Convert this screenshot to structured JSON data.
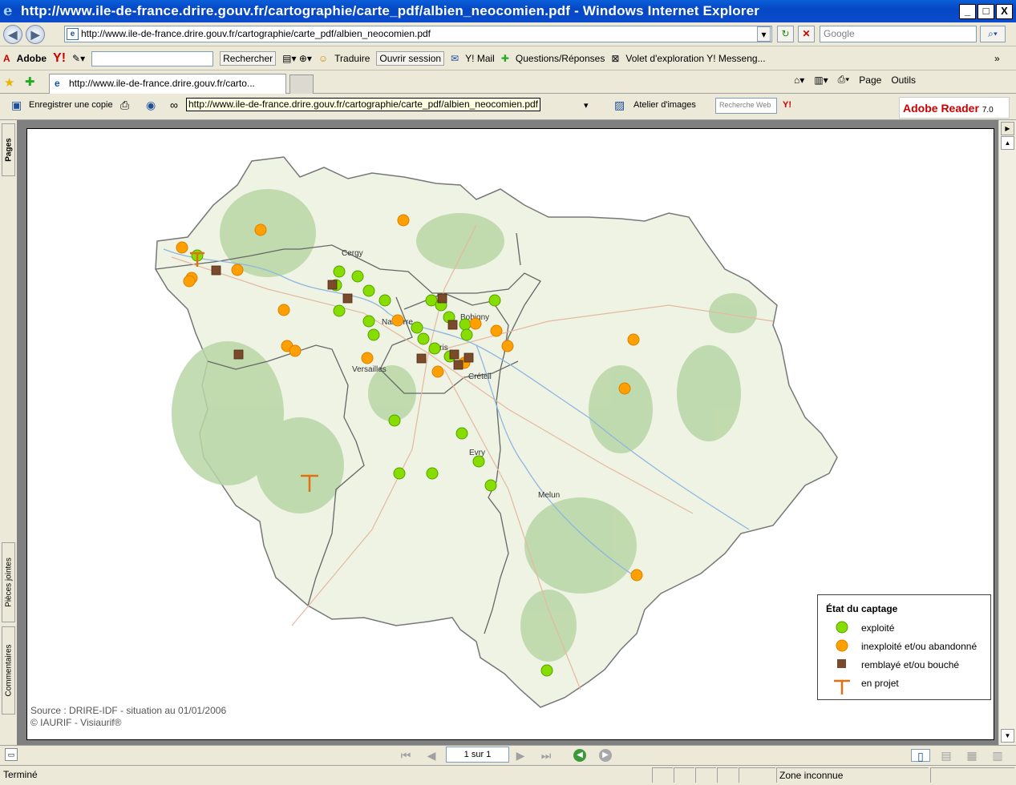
{
  "window": {
    "title": "http://www.ile-de-france.drire.gouv.fr/cartographie/carte_pdf/albien_neocomien.pdf - Windows Internet Explorer",
    "minimize": "_",
    "maximize": "□",
    "close": "X"
  },
  "address": {
    "url": "http://www.ile-de-france.drire.gouv.fr/cartographie/carte_pdf/albien_neocomien.pdf",
    "search_placeholder": "Google"
  },
  "links_toolbar": {
    "adobe": "Adobe",
    "yahoo": "Y!",
    "rechercher": "Rechercher",
    "traduire": "Traduire",
    "ouvrir_session": "Ouvrir session",
    "ymail": "Y! Mail",
    "questions": "Questions/Réponses",
    "volet": "Volet d'exploration Y! Messeng...",
    "more": "»"
  },
  "tabs": {
    "tab1": "http://www.ile-de-france.drire.gouv.fr/carto...",
    "page_menu": "Page",
    "outils_menu": "Outils"
  },
  "pdf_toolbar": {
    "save_copy": "Enregistrer une copie",
    "atelier": "Atelier d'images",
    "recherche_web": "Recherche Web",
    "adobe_reader": "Adobe Reader",
    "adobe_version": "7.0",
    "tooltip": "http://www.ile-de-france.drire.gouv.fr/cartographie/carte_pdf/albien_neocomien.pdf"
  },
  "side_tabs": {
    "pages": "Pages",
    "pieces": "Pièces jointes",
    "commentaires": "Commentaires"
  },
  "map": {
    "cities": [
      {
        "name": "Cergy"
      },
      {
        "name": "Nanterre"
      },
      {
        "name": "Bobigny"
      },
      {
        "name": "Paris"
      },
      {
        "name": "Versailles"
      },
      {
        "name": "Créteil"
      },
      {
        "name": "Evry"
      },
      {
        "name": "Melun"
      }
    ],
    "legend": {
      "title": "État du captage",
      "items": [
        {
          "label": "exploité",
          "color": "#88dd00"
        },
        {
          "label": "inexploité et/ou abandonné",
          "color": "#ff9f00"
        },
        {
          "label": "remblayé et/ou bouché",
          "color": "#7b4a2a"
        },
        {
          "label": "en projet",
          "color": "#e07010"
        }
      ]
    },
    "source_line1": "Source :  DRIRE-IDF - situation au 01/01/2006",
    "source_line2": "© IAURIF - Visiaurif®"
  },
  "navigation": {
    "page_field": "1 sur 1"
  },
  "status": {
    "left": "Terminé",
    "zone": "Zone inconnue"
  }
}
